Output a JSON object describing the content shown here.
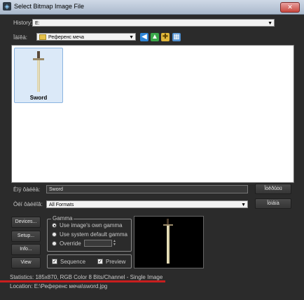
{
  "window": {
    "title": "Select Bitmap Image File",
    "close_glyph": "✕"
  },
  "history": {
    "label": "History:",
    "value": "E:"
  },
  "look_in": {
    "label": "Ïàïêà:",
    "value": "Референс меча"
  },
  "toolbar_icons": [
    "back-icon",
    "up-folder-icon",
    "new-folder-icon",
    "view-menu-icon"
  ],
  "files": [
    {
      "name": "Sword"
    }
  ],
  "filename": {
    "label": "Èìÿ ôàéëà:",
    "value": "Sword",
    "open_label": "Îòêðûòü"
  },
  "filetype": {
    "label": "Òèï ôàéëîâ:",
    "value": "All Formats",
    "cancel_label": "Îòìåíà"
  },
  "buttons": {
    "devices": "Devices...",
    "setup": "Setup...",
    "info": "Info...",
    "view": "View"
  },
  "gamma": {
    "title": "Gamma",
    "options": [
      "Use image's own gamma",
      "Use system default gamma",
      "Override"
    ],
    "selected": 0,
    "override_value": ""
  },
  "sequence": {
    "label": "Sequence",
    "checked": true
  },
  "preview_toggle": {
    "label": "Preview",
    "checked": true
  },
  "statistics": "Statistics:  185x870, RGB Color 8 Bits/Channel - Single Image",
  "location": "Location:  E:\\Референс меча\\sword.jpg",
  "colors": {
    "accent_red": "#c81e1e",
    "dialog_bg": "#2b2b2b",
    "selection_bg": "#dbe9f8"
  }
}
